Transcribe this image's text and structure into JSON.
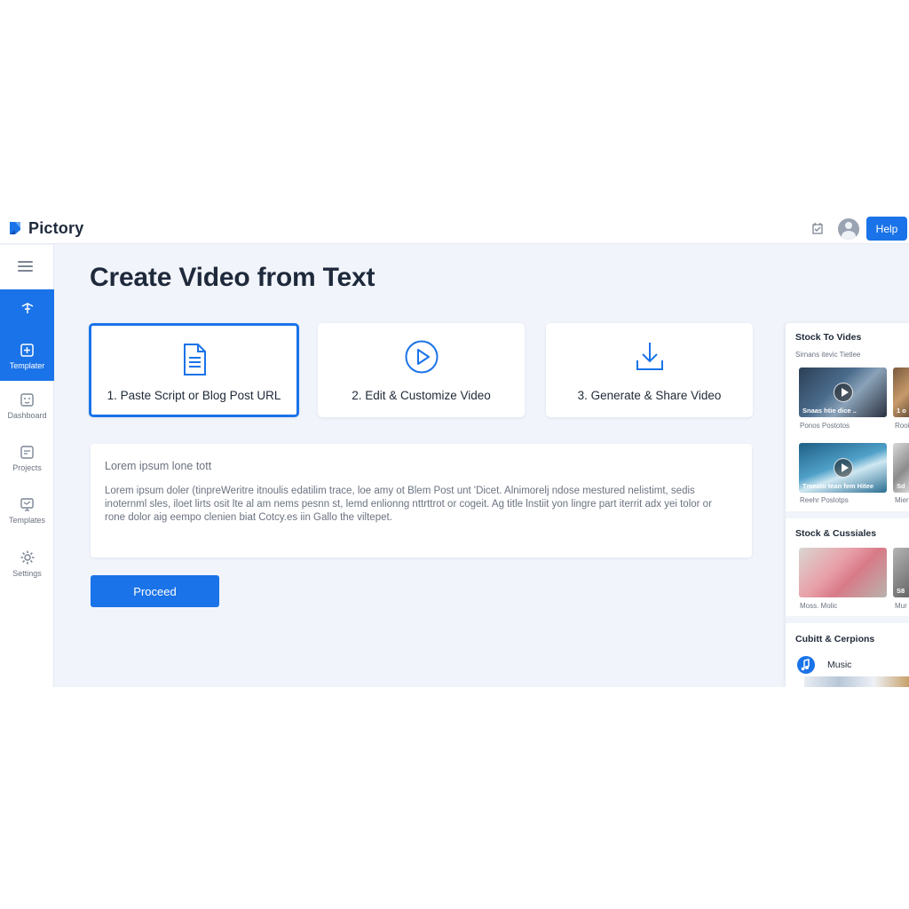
{
  "app": {
    "name": "Pictory",
    "help_label": "Help",
    "accent": "#1a73e8"
  },
  "sidebar": {
    "items": [
      {
        "label": "",
        "icon": "pin-icon",
        "active": true
      },
      {
        "label": "Templater",
        "icon": "add-template-icon",
        "active": true
      },
      {
        "label": "Dashboard",
        "icon": "dashboard-icon",
        "active": false
      },
      {
        "label": "Projects",
        "icon": "projects-icon",
        "active": false
      },
      {
        "label": "Templates",
        "icon": "templates-icon",
        "active": false
      },
      {
        "label": "Settings",
        "icon": "gear-icon",
        "active": false
      }
    ]
  },
  "main": {
    "title": "Create Video from Text",
    "steps": [
      {
        "label": "1. Paste Script or Blog Post URL",
        "icon": "document-icon",
        "active": true
      },
      {
        "label": "2. Edit & Customize Video",
        "icon": "play-circle-icon",
        "active": false
      },
      {
        "label": "3. Generate & Share Video",
        "icon": "download-icon",
        "active": false
      }
    ],
    "text_area": {
      "title": "Lorem ipsum lone tott",
      "lines": [
        "Lorem ipsum doler (tinpreWeritre itnoulis edatilim trace, loe amy ot Blem Post unt 'Dicet. Alnimorelj ndose mestured nelistimt, sedis",
        "inoternml sles, iloet lirts osit lte al am nems pesnn st, lemd enlionng nttrttrot or cogeit. Ag title lnstiit yon lingre part iterrit adx yei tolor or",
        "rone dolor aig eempo clenien biat Cotcy.es iin Gallo the viltepet."
      ]
    },
    "proceed_label": "Proceed"
  },
  "right_panel": {
    "section1": {
      "title": "Stock To Vides",
      "subtitle": "Sirnans itevic Tietlee",
      "thumbs": [
        {
          "caption": "Snaas htie dice ..",
          "label": "Ponos Postotos"
        },
        {
          "caption": "Tmeato tean fem Hitee",
          "label": "Reehr Poslotps"
        }
      ],
      "partial_labels": [
        "Rooi",
        "Mien"
      ],
      "partial_captions": [
        "1 o",
        "Sd"
      ]
    },
    "section2": {
      "title": "Stock & Cussiales",
      "thumbs": [
        {
          "caption": "",
          "label": "Moss. Molic"
        }
      ],
      "partial_labels": [
        "Mur"
      ],
      "partial_captions": [
        "S8"
      ]
    },
    "section3": {
      "title": "Cubitt & Cerpions",
      "music_label": "Music"
    }
  }
}
